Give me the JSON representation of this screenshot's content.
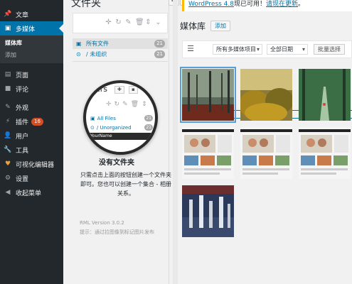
{
  "sidebar": {
    "items": [
      {
        "icon": "pin-icon",
        "label": "文章"
      },
      {
        "icon": "media-icon",
        "label": "多媒体",
        "current": true
      },
      {
        "icon": "page-icon",
        "label": "页面"
      },
      {
        "icon": "comment-icon",
        "label": "评论"
      },
      {
        "icon": "appearance-icon",
        "label": "外观"
      },
      {
        "icon": "plugin-icon",
        "label": "插件",
        "badge": "16"
      },
      {
        "icon": "user-icon",
        "label": "用户"
      },
      {
        "icon": "tools-icon",
        "label": "工具"
      },
      {
        "icon": "editor-icon",
        "label": "可视化编辑器"
      },
      {
        "icon": "settings-icon",
        "label": "设置"
      },
      {
        "icon": "collapse-icon",
        "label": "收起菜单"
      }
    ],
    "submenu": [
      {
        "label": "媒体库",
        "active": true
      },
      {
        "label": "添加"
      }
    ]
  },
  "folder_panel": {
    "title": "文件夹",
    "add_label": "✚",
    "add2_label": "⬛",
    "folders": [
      {
        "label": "所有文件",
        "count": "21"
      },
      {
        "label": "/ 未组织",
        "count": "21"
      }
    ],
    "magnifier": {
      "title": "ders",
      "add_label": "✚",
      "add2_label": "▪",
      "rows": [
        {
          "label": "All Files",
          "count": "21"
        },
        {
          "label": "/ Unorganized",
          "count": "21"
        }
      ],
      "name_bar": "YourName"
    },
    "empty_title": "没有文件夹",
    "empty_text": "只需点击上面的按钮创建一个文件夹即可。您也可以创建一个集合 - 相册关系。",
    "version": "RML Version 3.0.2",
    "hint": "提示：通过拉图像到标记图片发布"
  },
  "main": {
    "notice_text": "WordPress 4.8",
    "notice_suffix": "现已可用！",
    "notice_link": "请现在更新",
    "notice_end": "。",
    "page_title": "媒体库",
    "add_button": "添加",
    "filter_type": "所有多媒体项目",
    "filter_date": "全部日期",
    "bulk_select": "批量选择"
  },
  "colors": {
    "sidebar_bg": "#23282d",
    "accent": "#0073aa",
    "badge": "#d54e21",
    "notice_border": "#ffb900"
  }
}
